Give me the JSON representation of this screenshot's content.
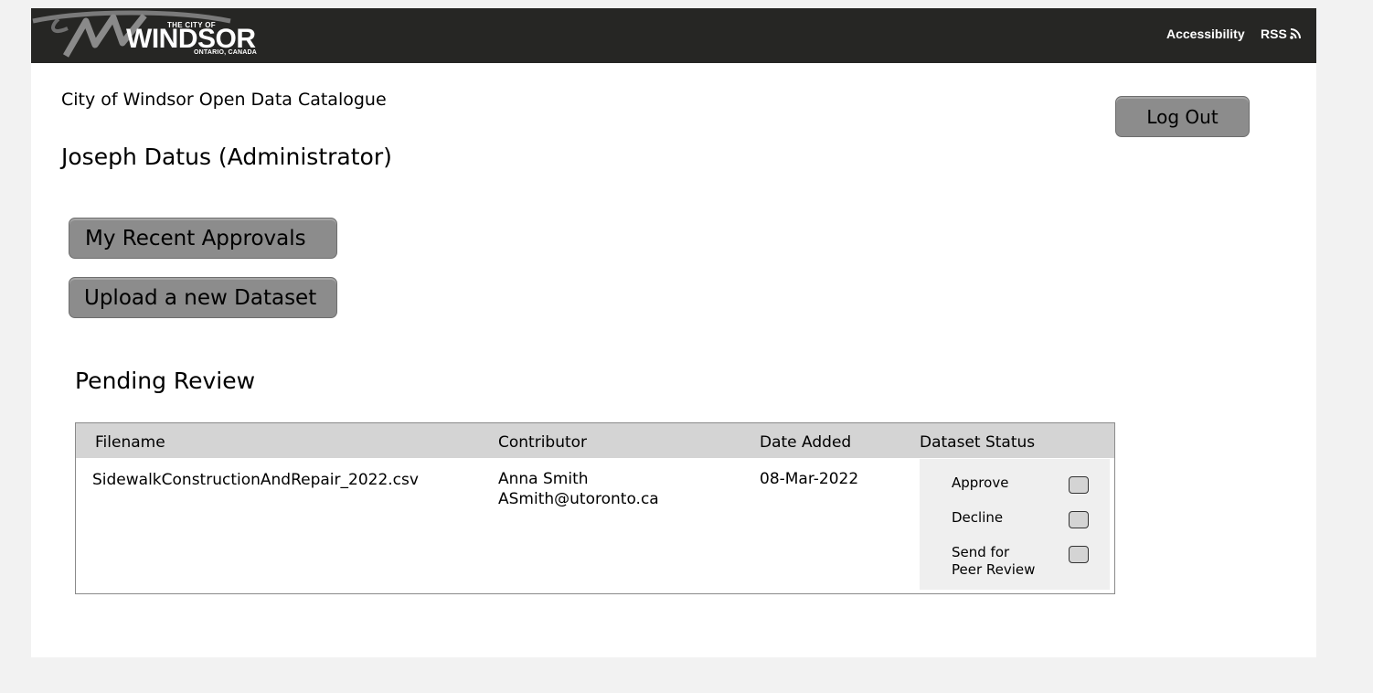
{
  "header": {
    "logo": {
      "top_text": "THE CITY OF",
      "main_text": "WINDSOR",
      "sub_text": "ONTARIO, CANADA"
    },
    "nav": {
      "accessibility": "Accessibility",
      "rss": "RSS",
      "rss_icon": "rss-icon"
    }
  },
  "page": {
    "catalogue_title": "City of Windsor Open Data Catalogue",
    "user_name": "Joseph Datus (Administrator)",
    "logout_label": "Log Out",
    "recent_approvals_label": "My Recent Approvals",
    "upload_label": "Upload a new Dataset"
  },
  "pending": {
    "title": "Pending Review",
    "columns": [
      "Filename",
      "Contributor",
      "Date Added",
      "Dataset Status"
    ],
    "rows": [
      {
        "filename": "SidewalkConstructionAndRepair_2022.csv",
        "contributor_name": "Anna Smith",
        "contributor_email": "ASmith@utoronto.ca",
        "date_added": "08-Mar-2022",
        "status_options": [
          "Approve",
          "Decline",
          "Send for",
          "Peer Review"
        ]
      }
    ]
  },
  "colors": {
    "topbar": "#262624",
    "button": "#8c8c8c",
    "table_header": "#d4d4d4",
    "status_panel": "#efefef",
    "page_bg": "#f2f2f2"
  }
}
